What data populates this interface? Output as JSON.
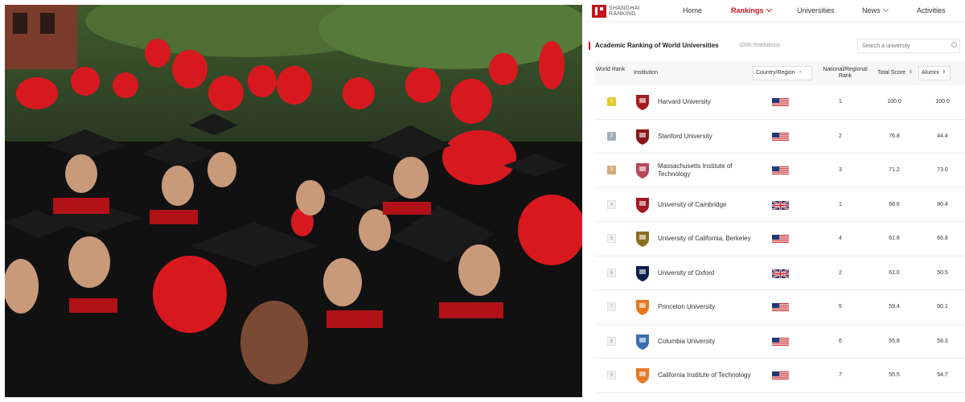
{
  "nav": {
    "logo_line1": "SHANGHAI",
    "logo_line2": "RANKING",
    "links": [
      {
        "label": "Home",
        "has_chevron": false,
        "active": false
      },
      {
        "label": "Rankings",
        "has_chevron": true,
        "active": true
      },
      {
        "label": "Universities",
        "has_chevron": false,
        "active": false
      },
      {
        "label": "News",
        "has_chevron": true,
        "active": false
      },
      {
        "label": "Activities",
        "has_chevron": false,
        "active": false
      }
    ]
  },
  "ranking": {
    "title": "Academic Ranking of World Universities",
    "count": "1000 Institutions",
    "search_placeholder": "Search a university"
  },
  "table": {
    "headers": {
      "world_rank": "World Rank",
      "institution": "Institution",
      "country": "Country/Region",
      "national_rank": "National/Regional Rank",
      "total_score": "Total Score",
      "alumni": "Alumni"
    },
    "rows": [
      {
        "world_rank": "1",
        "institution": "Harvard University",
        "country_flag": "us-flag-icon",
        "national_rank": "1",
        "total_score": "100.0",
        "alumni": "100.0",
        "badge": "gold",
        "crest_color": "#a41c1c"
      },
      {
        "world_rank": "2",
        "institution": "Stanford University",
        "country_flag": "us-flag-icon",
        "national_rank": "2",
        "total_score": "76.8",
        "alumni": "44.4",
        "badge": "silver",
        "crest_color": "#8c1515"
      },
      {
        "world_rank": "3",
        "institution": "Massachusetts Institute of Technology",
        "country_flag": "us-flag-icon",
        "national_rank": "3",
        "total_score": "71.2",
        "alumni": "73.0",
        "badge": "bronze",
        "crest_color": "#b8485a"
      },
      {
        "world_rank": "4",
        "institution": "University of Cambridge",
        "country_flag": "uk-flag-icon",
        "national_rank": "1",
        "total_score": "68.6",
        "alumni": "80.4",
        "badge": "plain",
        "crest_color": "#a3171f"
      },
      {
        "world_rank": "5",
        "institution": "University of California, Berkeley",
        "country_flag": "us-flag-icon",
        "national_rank": "4",
        "total_score": "61.8",
        "alumni": "66.8",
        "badge": "plain",
        "crest_color": "#8a6d1e"
      },
      {
        "world_rank": "6",
        "institution": "University of Oxford",
        "country_flag": "uk-flag-icon",
        "national_rank": "2",
        "total_score": "61.0",
        "alumni": "50.5",
        "badge": "plain",
        "crest_color": "#0b1f4b"
      },
      {
        "world_rank": "7",
        "institution": "Princeton University",
        "country_flag": "us-flag-icon",
        "national_rank": "5",
        "total_score": "59.4",
        "alumni": "60.1",
        "badge": "plain",
        "crest_color": "#e87722"
      },
      {
        "world_rank": "8",
        "institution": "Columbia University",
        "country_flag": "us-flag-icon",
        "national_rank": "6",
        "total_score": "55.8",
        "alumni": "58.3",
        "badge": "plain",
        "crest_color": "#3a6fb0"
      },
      {
        "world_rank": "9",
        "institution": "California Institute of Technology",
        "country_flag": "us-flag-icon",
        "national_rank": "7",
        "total_score": "55.5",
        "alumni": "54.7",
        "badge": "plain",
        "crest_color": "#e87722"
      }
    ]
  },
  "colors": {
    "accent": "#c4161c",
    "gold": "#e3c92e",
    "silver": "#9fb0bd",
    "bronze": "#d8a97a"
  }
}
